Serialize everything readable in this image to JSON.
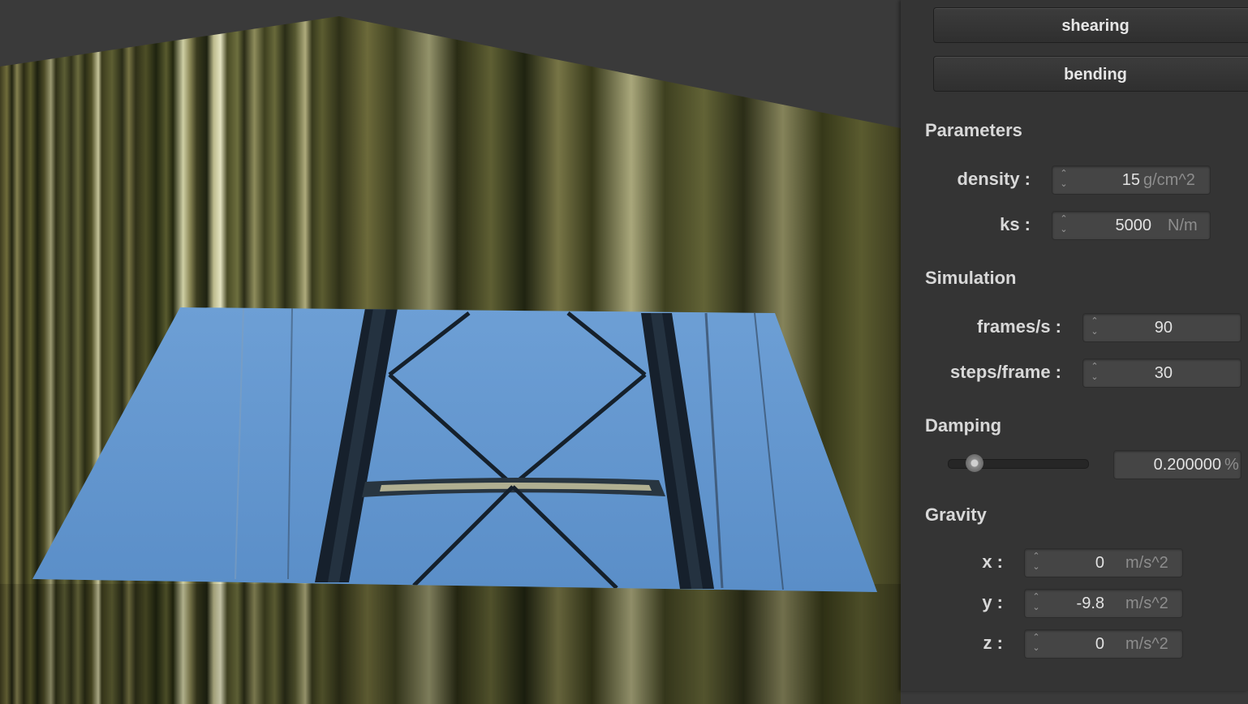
{
  "panel": {
    "buttons": {
      "shearing": "shearing",
      "bending": "bending"
    },
    "parameters": {
      "title": "Parameters",
      "density": {
        "label": "density :",
        "value": "15",
        "unit": "g/cm^2"
      },
      "ks": {
        "label": "ks :",
        "value": "5000",
        "unit": "N/m"
      }
    },
    "simulation": {
      "title": "Simulation",
      "fps": {
        "label": "frames/s :",
        "value": "90"
      },
      "steps": {
        "label": "steps/frame :",
        "value": "30"
      }
    },
    "damping": {
      "title": "Damping",
      "value": "0.200000",
      "unit": "%",
      "slider_fraction": 0.2
    },
    "gravity": {
      "title": "Gravity",
      "x": {
        "label": "x :",
        "value": "0",
        "unit": "m/s^2"
      },
      "y": {
        "label": "y :",
        "value": "-9.8",
        "unit": "m/s^2"
      },
      "z": {
        "label": "z :",
        "value": "0",
        "unit": "m/s^2"
      }
    }
  },
  "scene": {
    "colors": {
      "background": "#3a3a3a",
      "sky": "#6a9cd2",
      "truss": "#1c2530",
      "wall_dark": "#3a3a1c",
      "wall_light": "#b8b88a"
    }
  }
}
